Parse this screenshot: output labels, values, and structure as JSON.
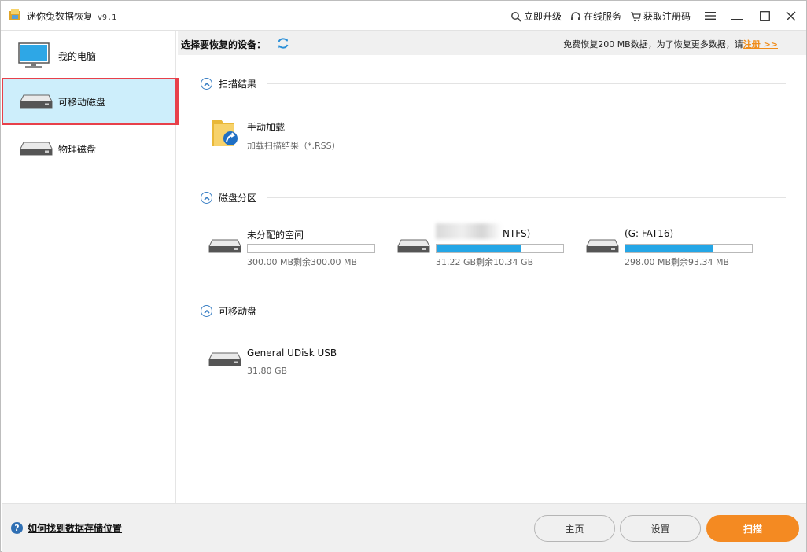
{
  "titlebar": {
    "title": "迷你兔数据恢复",
    "version": "v9.1",
    "upgrade": "立即升级",
    "service": "在线服务",
    "register_code": "获取注册码"
  },
  "sidebar": {
    "items": [
      {
        "label": "我的电脑",
        "icon": "monitor-icon"
      },
      {
        "label": "可移动磁盘",
        "icon": "disk-icon",
        "active": true
      },
      {
        "label": "物理磁盘",
        "icon": "disk-icon"
      }
    ]
  },
  "header": {
    "select_device": "选择要恢复的设备：",
    "free_note": "免费恢复200 MB数据，为了恢复更多数据，请",
    "register_link": "注册 >>"
  },
  "sections": {
    "scan_results": {
      "title": "扫描结果",
      "item": {
        "name": "手动加载",
        "sub": "加载扫描结果（*.RSS）"
      }
    },
    "partitions": {
      "title": "磁盘分区",
      "items": [
        {
          "name": "未分配的空间",
          "sub": "300.00 MB剩余300.00 MB",
          "used": 0
        },
        {
          "name": "NTFS)",
          "sub": "31.22 GB剩余10.34 GB",
          "used": 0.67
        },
        {
          "name": "(G: FAT16)",
          "sub": "298.00 MB剩余93.34 MB",
          "used": 0.69
        }
      ]
    },
    "removable": {
      "title": "可移动盘",
      "item": {
        "name": "General UDisk USB",
        "sub": "31.80 GB"
      }
    }
  },
  "footer": {
    "help": "如何找到数据存储位置",
    "home": "主页",
    "settings": "设置",
    "scan": "扫描"
  },
  "colors": {
    "accent_orange": "#f48a22",
    "selection_bg": "#cdeefb",
    "selection_border": "#e8404a",
    "bar_fill": "#24a6e6"
  }
}
